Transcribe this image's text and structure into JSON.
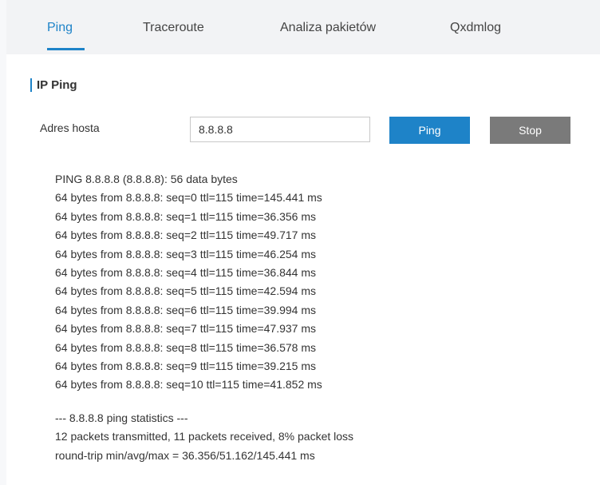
{
  "tabs": [
    {
      "label": "Ping",
      "active": true
    },
    {
      "label": "Traceroute",
      "active": false
    },
    {
      "label": "Analiza pakietów",
      "active": false
    },
    {
      "label": "Qxdmlog",
      "active": false
    }
  ],
  "section": {
    "title": "IP Ping"
  },
  "form": {
    "host_label": "Adres hosta",
    "host_value": "8.8.8.8",
    "ping_button": "Ping",
    "stop_button": "Stop"
  },
  "output": {
    "lines": [
      "PING 8.8.8.8 (8.8.8.8): 56 data bytes",
      "64 bytes from 8.8.8.8: seq=0 ttl=115 time=145.441 ms",
      "64 bytes from 8.8.8.8: seq=1 ttl=115 time=36.356 ms",
      "64 bytes from 8.8.8.8: seq=2 ttl=115 time=49.717 ms",
      "64 bytes from 8.8.8.8: seq=3 ttl=115 time=46.254 ms",
      "64 bytes from 8.8.8.8: seq=4 ttl=115 time=36.844 ms",
      "64 bytes from 8.8.8.8: seq=5 ttl=115 time=42.594 ms",
      "64 bytes from 8.8.8.8: seq=6 ttl=115 time=39.994 ms",
      "64 bytes from 8.8.8.8: seq=7 ttl=115 time=47.937 ms",
      "64 bytes from 8.8.8.8: seq=8 ttl=115 time=36.578 ms",
      "64 bytes from 8.8.8.8: seq=9 ttl=115 time=39.215 ms",
      "64 bytes from 8.8.8.8: seq=10 ttl=115 time=41.852 ms"
    ],
    "stats": [
      "--- 8.8.8.8 ping statistics ---",
      "12 packets transmitted, 11 packets received, 8% packet loss",
      "round-trip min/avg/max = 36.356/51.162/145.441 ms"
    ]
  },
  "colors": {
    "accent": "#1e83c8",
    "stop_button": "#7a7a7a",
    "tabbar_bg": "#f2f3f5"
  }
}
